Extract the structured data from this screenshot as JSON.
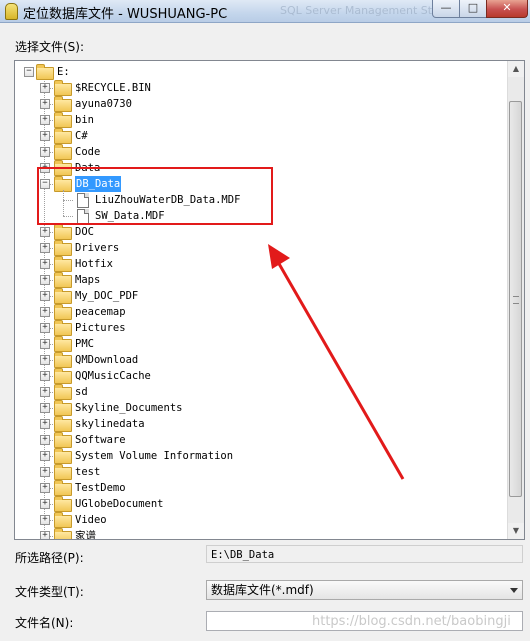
{
  "window": {
    "title": "定位数据库文件 - WUSHUANG-PC",
    "title_ghost": "SQL Server Management Studio",
    "minimize_glyph": "—",
    "maximize_glyph": "□",
    "close_glyph": "✕"
  },
  "select_file_label": "选择文件(S):",
  "tree": {
    "root": "E:",
    "folders_before": [
      "$RECYCLE.BIN",
      "ayuna0730",
      "bin",
      "C#",
      "Code",
      "Data"
    ],
    "selected_folder": "DB_Data",
    "selected_files": [
      "LiuZhouWaterDB_Data.MDF",
      "SW_Data.MDF"
    ],
    "folders_after": [
      "DOC",
      "Drivers",
      "Hotfix",
      "Maps",
      "My_DOC_PDF",
      "peacemap",
      "Pictures",
      "PMC",
      "QMDownload",
      "QQMusicCache",
      "sd",
      "Skyline_Documents",
      "skylinedata",
      "Software",
      "System Volume Information",
      "test",
      "TestDemo",
      "UGlobeDocument",
      "Video",
      "家谱"
    ]
  },
  "fields": {
    "selected_path_label": "所选路径(P):",
    "selected_path_value": "E:\\DB_Data",
    "file_type_label": "文件类型(T):",
    "file_type_value": "数据库文件(*.mdf)",
    "file_name_label": "文件名(N):",
    "file_name_value": ""
  },
  "watermark": "https://blog.csdn.net/baobingji",
  "colors": {
    "highlight": "#e21a1a",
    "selection": "#3399ff"
  },
  "icons": [
    "app-icon",
    "folder-icon",
    "file-icon",
    "expander-icon",
    "chevron-down-icon"
  ]
}
